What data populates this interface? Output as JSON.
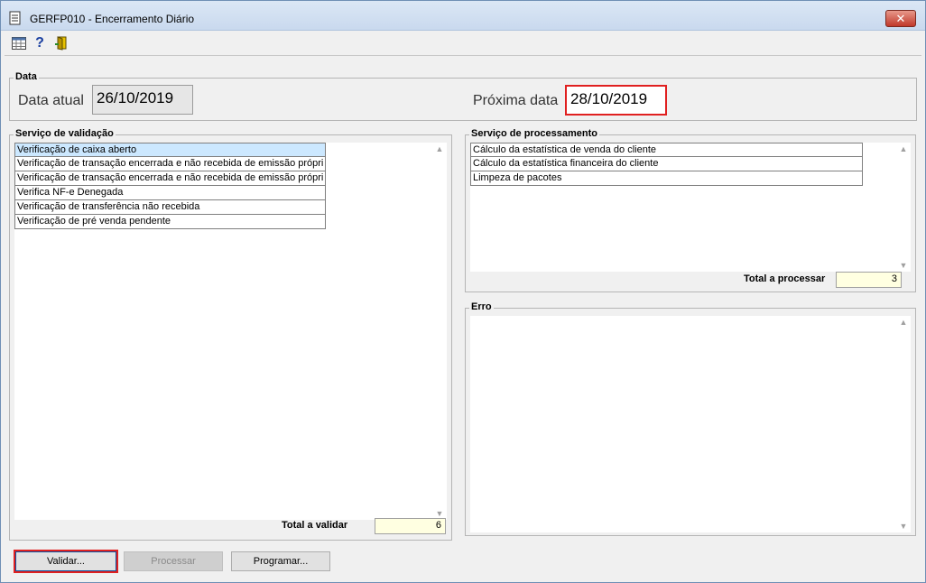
{
  "window": {
    "title": "GERFP010 - Encerramento Diário",
    "close_label": "✕"
  },
  "toolbar": {
    "items": [
      "calendar-grid-icon",
      "help-icon",
      "exit-door-icon"
    ],
    "help_glyph": "?"
  },
  "data_group": {
    "title": "Data",
    "current_label": "Data atual",
    "current_value": "26/10/2019",
    "next_label": "Próxima data",
    "next_value": "28/10/2019"
  },
  "validation": {
    "title": "Serviço de validação",
    "items": [
      "Verificação de caixa aberto",
      "Verificação de transação encerrada e não recebida de emissão própri",
      "Verificação de transação encerrada e não recebida de emissão própri",
      "Verifica NF-e Denegada",
      "Verificação de transferência não recebida",
      "Verificação de pré venda pendente"
    ],
    "selected_index": 0,
    "total_label": "Total a validar",
    "total_value": "6"
  },
  "processing": {
    "title": "Serviço de processamento",
    "items": [
      "Cálculo da estatística de venda do cliente",
      "Cálculo da estatística financeira do cliente",
      "Limpeza de pacotes"
    ],
    "total_label": "Total a processar",
    "total_value": "3"
  },
  "error": {
    "title": "Erro"
  },
  "buttons": {
    "validate": "Validar...",
    "process": "Processar",
    "schedule": "Programar..."
  },
  "colors": {
    "highlight": "#e02020",
    "selection": "#cce8ff",
    "total_bg": "#ffffe1"
  }
}
